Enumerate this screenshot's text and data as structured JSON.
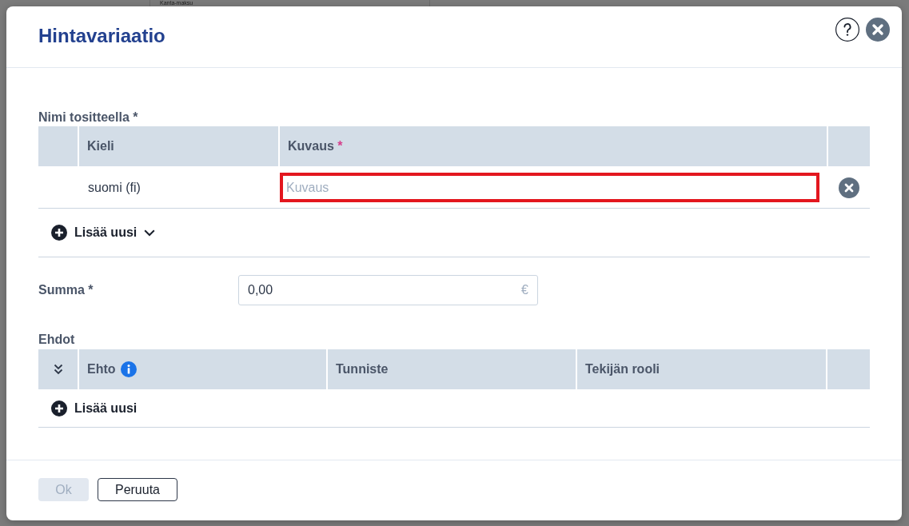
{
  "background": {
    "label": "Kanta-maksu"
  },
  "dialog": {
    "title": "Hintavariaatio"
  },
  "name_section": {
    "label": "Nimi tositteella *",
    "columns": [
      {
        "label": "Kieli"
      },
      {
        "label": "Kuvaus",
        "marker": "*"
      }
    ],
    "rows": [
      {
        "language": "suomi (fi)",
        "description": {
          "placeholder": "Kuvaus",
          "invalid": true
        }
      }
    ],
    "add_button": {
      "label": "Lisää uusi",
      "dropdown": true
    }
  },
  "amount": {
    "label": "Summa *",
    "value": "0,00",
    "suffix": "€"
  },
  "conditions": {
    "label": "Ehdot",
    "columns": [
      {
        "label": "Ehto",
        "info": true
      },
      {
        "label": "Tunniste",
        "info": false
      },
      {
        "label": "Tekijän rooli",
        "info": false
      }
    ],
    "add_button": {
      "label": "Lisää uusi",
      "dropdown": false
    }
  },
  "buttons": [
    {
      "label": "Ok",
      "kind": "primary",
      "disabled": true
    },
    {
      "label": "Peruuta",
      "kind": "secondary",
      "disabled": false
    }
  ]
}
